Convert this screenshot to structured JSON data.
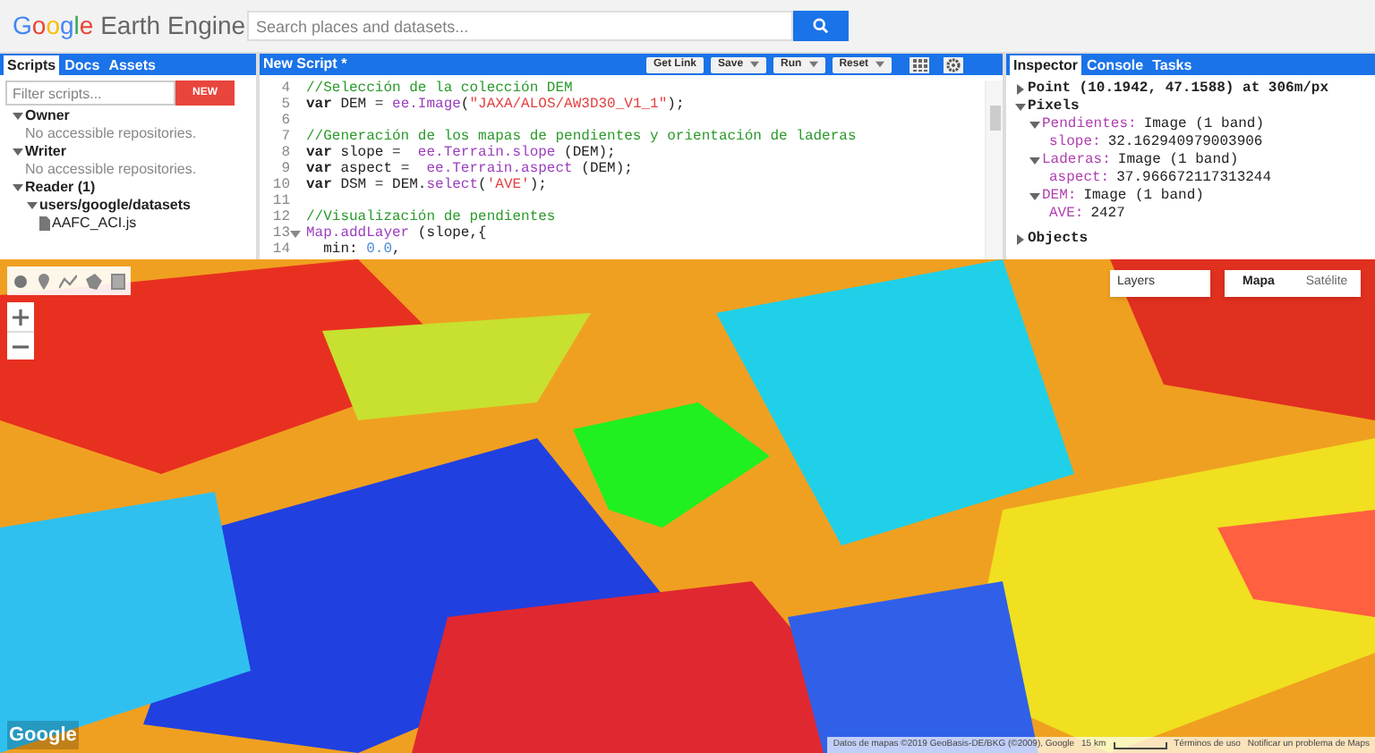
{
  "header": {
    "logo": "Google Earth Engine",
    "search": {
      "placeholder": "Search places and datasets..."
    }
  },
  "scripts_panel": {
    "tabs": [
      {
        "label": "Scripts",
        "selected": true
      },
      {
        "label": "Docs",
        "selected": false
      },
      {
        "label": "Assets",
        "selected": false
      }
    ],
    "filter": {
      "placeholder": "Filter scripts..."
    },
    "new_button": "NEW",
    "tree": [
      {
        "label": "Owner",
        "expanded": true,
        "kind": "group",
        "children": [
          {
            "label": "No accessible repositories.",
            "kind": "message"
          }
        ]
      },
      {
        "label": "Writer",
        "expanded": true,
        "kind": "group",
        "children": [
          {
            "label": "No accessible repositories.",
            "kind": "message"
          }
        ]
      },
      {
        "label": "Reader (1)",
        "expanded": true,
        "kind": "group",
        "children": [
          {
            "label": "users/google/datasets",
            "expanded": true,
            "kind": "group",
            "children": [
              {
                "label": "AAFC_ACI.js",
                "kind": "file"
              }
            ]
          }
        ]
      }
    ]
  },
  "editor": {
    "title": "New Script *",
    "buttons": [
      {
        "label": "Get Link",
        "dropdown": false
      },
      {
        "label": "Save",
        "dropdown": true
      },
      {
        "label": "Run",
        "dropdown": true
      },
      {
        "label": "Reset",
        "dropdown": true
      }
    ],
    "lines": [
      {
        "number": "4",
        "tokens": [
          {
            "kind": "comment",
            "text": "//Selección de la colección DEM"
          }
        ]
      },
      {
        "number": "5",
        "tokens": [
          {
            "kind": "keyword",
            "text": "var"
          },
          {
            "kind": "plain",
            "text": " DEM = "
          },
          {
            "kind": "function",
            "text": "ee.Image"
          },
          {
            "kind": "plain",
            "text": "("
          },
          {
            "kind": "string",
            "text": "\"JAXA/ALOS/AW3D30_V1_1\""
          },
          {
            "kind": "plain",
            "text": ");"
          }
        ]
      },
      {
        "number": "6"
      },
      {
        "number": "7",
        "tokens": [
          {
            "kind": "comment",
            "text": "//Generación de los mapas de pendientes y orientación de laderas"
          }
        ]
      },
      {
        "number": "8",
        "tokens": [
          {
            "kind": "keyword",
            "text": "var"
          },
          {
            "kind": "plain",
            "text": " slope =  "
          },
          {
            "kind": "function",
            "text": "ee.Terrain.slope"
          },
          {
            "kind": "plain",
            "text": " (DEM);"
          }
        ]
      },
      {
        "number": "9",
        "tokens": [
          {
            "kind": "keyword",
            "text": "var"
          },
          {
            "kind": "plain",
            "text": " aspect =  "
          },
          {
            "kind": "function",
            "text": "ee.Terrain.aspect"
          },
          {
            "kind": "plain",
            "text": " (DEM);"
          }
        ]
      },
      {
        "number": "10",
        "tokens": [
          {
            "kind": "keyword",
            "text": "var"
          },
          {
            "kind": "plain",
            "text": " DSM = DEM."
          },
          {
            "kind": "function",
            "text": "select"
          },
          {
            "kind": "plain",
            "text": "("
          },
          {
            "kind": "string",
            "text": "'AVE'"
          },
          {
            "kind": "plain",
            "text": ");"
          }
        ]
      },
      {
        "number": "11"
      },
      {
        "number": "12",
        "tokens": [
          {
            "kind": "comment",
            "text": "//Visualización de pendientes"
          }
        ]
      },
      {
        "number": "13",
        "fold": true,
        "tokens": [
          {
            "kind": "function",
            "text": "Map.addLayer"
          },
          {
            "kind": "plain",
            "text": " (slope,{"
          }
        ]
      },
      {
        "number": "14",
        "tokens": [
          {
            "kind": "plain",
            "text": "  min: "
          },
          {
            "kind": "number",
            "text": "0.0"
          },
          {
            "kind": "plain",
            "text": ","
          }
        ]
      }
    ]
  },
  "inspector": {
    "tabs": [
      {
        "label": "Inspector",
        "selected": true
      },
      {
        "label": "Console",
        "selected": false
      },
      {
        "label": "Tasks",
        "selected": false
      }
    ],
    "entries": [
      {
        "key": "Point (10.1942, 47.1588) at 306m/px",
        "expanded": false
      },
      {
        "key": "Pixels",
        "expanded": true,
        "children": [
          {
            "key": "Pendientes:",
            "value": "Image (1 band)",
            "expanded": true,
            "children": [
              {
                "key": "slope:",
                "value": "32.162940979003906"
              }
            ]
          },
          {
            "key": "Laderas:",
            "value": "Image (1 band)",
            "expanded": true,
            "children": [
              {
                "key": "aspect:",
                "value": "37.966672117313244"
              }
            ]
          },
          {
            "key": "DEM:",
            "value": "Image (1 band)",
            "expanded": true,
            "children": [
              {
                "key": "AVE:",
                "value": "2427"
              }
            ]
          }
        ]
      },
      {
        "key": "Objects",
        "expanded": false
      }
    ]
  },
  "map": {
    "layers_button": "Layers",
    "map_types": [
      {
        "label": "Mapa",
        "selected": true
      },
      {
        "label": "Satélite",
        "selected": false
      }
    ],
    "logo": "Google",
    "attribution": [
      "Datos de mapas ©2019 GeoBasis-DE/BKG (©2009), Google",
      "15 km",
      "Términos de uso",
      "Notificar un problema de Maps"
    ]
  }
}
